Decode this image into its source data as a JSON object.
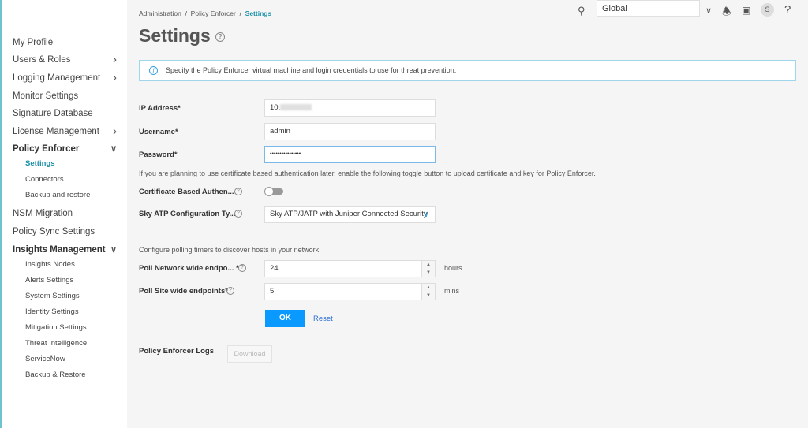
{
  "sidebar": {
    "items": [
      {
        "label": "My Profile",
        "chevron": false
      },
      {
        "label": "Users & Roles",
        "chevron": true
      },
      {
        "label": "Logging Management",
        "chevron": true
      },
      {
        "label": "Monitor Settings",
        "chevron": false
      },
      {
        "label": "Signature Database",
        "chevron": false
      },
      {
        "label": "License Management",
        "chevron": true
      },
      {
        "label": "Policy Enforcer",
        "expanded": true,
        "children": [
          "Settings",
          "Connectors",
          "Backup and restore"
        ]
      },
      {
        "label": "NSM Migration"
      },
      {
        "label": "Policy Sync Settings"
      },
      {
        "label": "Insights Management",
        "expanded": true,
        "children": [
          "Insights Nodes",
          "Alerts Settings",
          "System Settings",
          "Identity Settings",
          "Mitigation Settings",
          "Threat Intelligence",
          "ServiceNow",
          "Backup & Restore"
        ]
      }
    ],
    "active": "Settings"
  },
  "header": {
    "breadcrumb": [
      "Administration",
      "Policy Enforcer",
      "Settings"
    ],
    "domain_select": "Global",
    "avatar": "S",
    "help": "?"
  },
  "page": {
    "title": "Settings",
    "info": "Specify the Policy Enforcer virtual machine and login credentials to use for threat prevention."
  },
  "form": {
    "ip_label": "IP Address*",
    "ip_value": "10.",
    "username_label": "Username*",
    "username_value": "admin",
    "password_label": "Password*",
    "password_value": "••••••••••••••••",
    "cert_note": "If you are planning to use certificate based authentication later, enable the following toggle button to upload certificate and key for Policy Enforcer.",
    "cert_label": "Certificate Based Authen...",
    "cert_toggle": false,
    "skyatp_label": "Sky ATP Configuration Ty...",
    "skyatp_value": "Sky ATP/JATP with Juniper Connected Security",
    "poll_note": "Configure polling timers to discover hosts in your network",
    "poll_network_label": "Poll Network wide endpo... *",
    "poll_network_value": "24",
    "poll_network_unit": "hours",
    "poll_site_label": "Poll Site wide endpoints*",
    "poll_site_value": "5",
    "poll_site_unit": "mins",
    "ok": "OK",
    "reset": "Reset",
    "logs_label": "Policy Enforcer Logs",
    "download": "Download"
  },
  "colors": {
    "accent": "#1a8fa8",
    "primary_button": "#0a9aff"
  }
}
